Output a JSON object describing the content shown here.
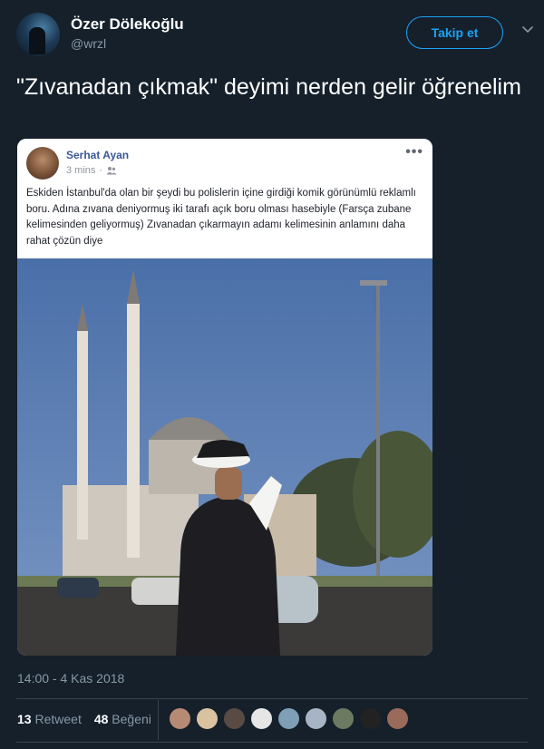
{
  "author": {
    "display_name": "Özer Dölekoğlu",
    "handle": "@wrzl"
  },
  "follow_button_label": "Takip et",
  "tweet": {
    "text": "\"Zıvanadan çıkmak\" deyimi nerden gelir öğrenelim",
    "timestamp": "14:00 - 4 Kas 2018"
  },
  "embedded_post": {
    "author": "Serhat Ayan",
    "time": "3 mins",
    "body": "Eskiden İstanbul'da olan bir şeydi bu polislerin içine girdiği komik görünümlü reklamlı boru. Adına zıvana deniyormuş iki tarafı açık boru olması hasebiyle (Farsça zubane kelimesinden geliyormuş) Zıvanadan çıkarmayın adamı kelimesinin anlamını daha rahat çözün diye",
    "more_label": "•••"
  },
  "stats": {
    "retweets_count": "13",
    "retweets_label": "Retweet",
    "likes_count": "48",
    "likes_label": "Beğeni"
  },
  "likers": [
    {
      "color": "#b78a74"
    },
    {
      "color": "#d9c2a0"
    },
    {
      "color": "#5a4a44"
    },
    {
      "color": "#e6e6e6"
    },
    {
      "color": "#7e9fb5"
    },
    {
      "color": "#a7b4c6"
    },
    {
      "color": "#6b7a60"
    },
    {
      "color": "#222222"
    },
    {
      "color": "#9a6a5a"
    }
  ],
  "colors": {
    "background": "#15202b",
    "accent": "#1da1f2",
    "secondary_text": "#8899a6",
    "fb_name": "#385898"
  }
}
